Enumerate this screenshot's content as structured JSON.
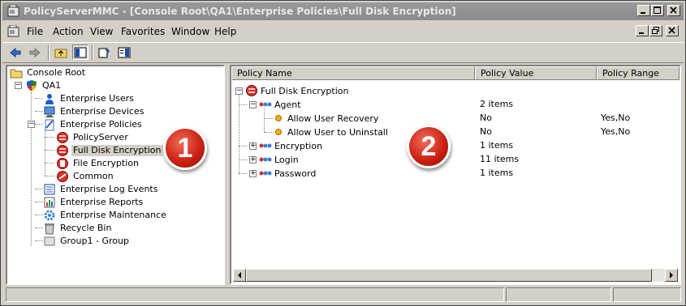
{
  "window": {
    "title": "PolicyServerMMC - [Console Root\\QA1\\Enterprise Policies\\Full Disk Encryption]"
  },
  "menu": [
    "File",
    "Action",
    "View",
    "Favorites",
    "Window",
    "Help"
  ],
  "tree": [
    {
      "label": "Console Root",
      "icon": "folder-icon"
    },
    {
      "label": "QA1",
      "icon": "shield-icon"
    },
    {
      "label": "Enterprise Users",
      "icon": "user-icon"
    },
    {
      "label": "Enterprise Devices",
      "icon": "computer-icon"
    },
    {
      "label": "Enterprise Policies",
      "icon": "policy-icon"
    },
    {
      "label": "PolicyServer",
      "icon": "policy-item-icon"
    },
    {
      "label": "Full Disk Encryption",
      "icon": "disk-encryption-icon",
      "selected": true
    },
    {
      "label": "File Encryption",
      "icon": "file-encryption-icon"
    },
    {
      "label": "Common",
      "icon": "common-icon"
    },
    {
      "label": "Enterprise Log Events",
      "icon": "log-icon"
    },
    {
      "label": "Enterprise Reports",
      "icon": "reports-icon"
    },
    {
      "label": "Enterprise Maintenance",
      "icon": "maintenance-icon"
    },
    {
      "label": "Recycle Bin",
      "icon": "recycle-bin-icon"
    },
    {
      "label": "Group1 - Group",
      "icon": "group-icon"
    }
  ],
  "columns": [
    "Policy Name",
    "Policy Value",
    "Policy Range"
  ],
  "rows": [
    {
      "name": "Full Disk Encryption",
      "value": "",
      "range": ""
    },
    {
      "name": "Agent",
      "value": "2 items",
      "range": ""
    },
    {
      "name": "Allow User Recovery",
      "value": "No",
      "range": "Yes,No"
    },
    {
      "name": "Allow User to Uninstall",
      "value": "No",
      "range": "Yes,No"
    },
    {
      "name": "Encryption",
      "value": "1 items",
      "range": ""
    },
    {
      "name": "Login",
      "value": "11 items",
      "range": ""
    },
    {
      "name": "Password",
      "value": "1 items",
      "range": ""
    }
  ],
  "callouts": [
    "1",
    "2"
  ]
}
